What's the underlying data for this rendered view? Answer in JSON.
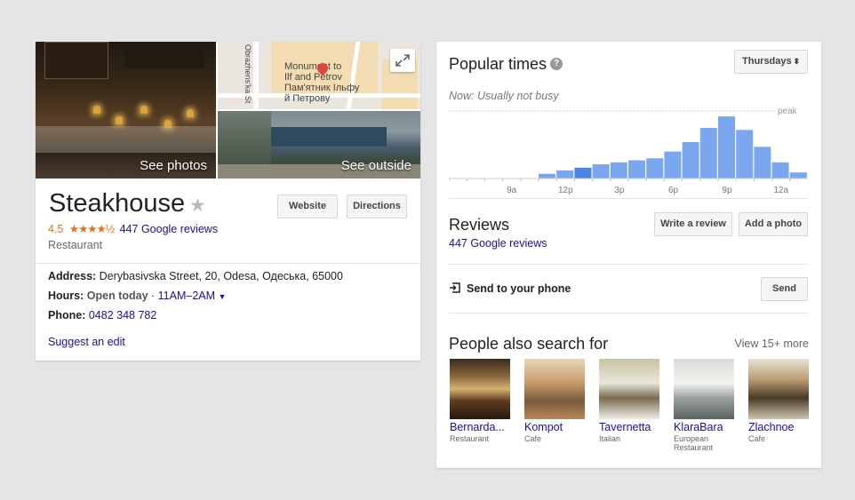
{
  "place": {
    "name": "Steakhouse",
    "rating": "4.5",
    "stars": "★★★★½",
    "reviews_link": "447 Google reviews",
    "category": "Restaurant"
  },
  "photos": {
    "see_photos": "See photos",
    "see_outside": "See outside",
    "map_labels": [
      "Monument to",
      "Ilf and Petrov",
      "Пам'ятник Ільфу",
      "й Петрову",
      "Obrazhens'ka St"
    ]
  },
  "actions": {
    "website": "Website",
    "directions": "Directions"
  },
  "details": {
    "address_label": "Address:",
    "address": "Derybasivska Street, 20, Odesa, Одеська, 65000",
    "hours_label": "Hours:",
    "hours_status": "Open today",
    "hours_sep": " · ",
    "hours_value": "11AM–2AM",
    "phone_label": "Phone:",
    "phone": "0482 348 782",
    "suggest_edit": "Suggest an edit"
  },
  "popular_times": {
    "title": "Popular times",
    "help": "?",
    "day": "Thursdays",
    "now": "Now: Usually not busy",
    "peak_label": "peak"
  },
  "chart_data": {
    "type": "bar",
    "categories": [
      "6a",
      "7a",
      "8a",
      "9a",
      "10a",
      "11a",
      "12p",
      "1p",
      "2p",
      "3p",
      "4p",
      "5p",
      "6p",
      "7p",
      "8p",
      "9p",
      "10p",
      "11p",
      "12a",
      "1a"
    ],
    "x_tick_labels": [
      "9a",
      "12p",
      "3p",
      "6p",
      "9p",
      "12a"
    ],
    "values": [
      0,
      0,
      0,
      0,
      0,
      7,
      12,
      16,
      21,
      24,
      27,
      30,
      40,
      54,
      75,
      92,
      72,
      47,
      24,
      9
    ],
    "current_index": 7,
    "ylim": [
      0,
      100
    ],
    "colors": {
      "bar": "#7ba7f0",
      "current": "#4a84e6"
    }
  },
  "reviews": {
    "title": "Reviews",
    "link": "447 Google reviews",
    "write_review": "Write a review",
    "add_photo": "Add a photo"
  },
  "send": {
    "label": "Send to your phone",
    "button": "Send"
  },
  "also_search": {
    "title": "People also search for",
    "view_more": "View 15+ more",
    "items": [
      {
        "name": "Bernarda...",
        "type": "Restaurant"
      },
      {
        "name": "Kompot",
        "type": "Cafe"
      },
      {
        "name": "Tavernetta",
        "type": "Italian"
      },
      {
        "name": "KlaraBara",
        "type": "European Restaurant"
      },
      {
        "name": "Zlachnoe",
        "type": "Cafe"
      }
    ]
  },
  "colors": {
    "link": "#1a0dab",
    "rating": "#e7711b",
    "bar": "#7ba7f0"
  }
}
